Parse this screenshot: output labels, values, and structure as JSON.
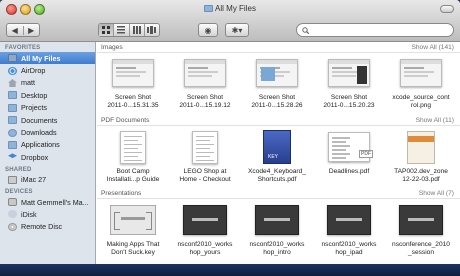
{
  "window": {
    "title": "All My Files"
  },
  "toolbar": {
    "back_glyph": "◀",
    "forward_glyph": "▶",
    "quicklook_glyph": "◉",
    "action_glyph": "✱▾",
    "search": {
      "value": "",
      "placeholder": ""
    }
  },
  "sidebar": {
    "favorites_header": "FAVORITES",
    "favorites": [
      {
        "label": "All My Files",
        "icon": "all-my-files-icon"
      },
      {
        "label": "AirDrop",
        "icon": "airdrop-icon"
      },
      {
        "label": "matt",
        "icon": "home-icon"
      },
      {
        "label": "Desktop",
        "icon": "folder-icon"
      },
      {
        "label": "Projects",
        "icon": "folder-icon"
      },
      {
        "label": "Documents",
        "icon": "documents-folder-icon"
      },
      {
        "label": "Downloads",
        "icon": "downloads-icon"
      },
      {
        "label": "Applications",
        "icon": "applications-icon"
      },
      {
        "label": "Dropbox",
        "icon": "dropbox-icon"
      }
    ],
    "shared_header": "SHARED",
    "shared": [
      {
        "label": "iMac 27",
        "icon": "imac-icon"
      }
    ],
    "devices_header": "DEVICES",
    "devices": [
      {
        "label": "Matt Gemmell's Ma...",
        "icon": "hard-disk-icon"
      },
      {
        "label": "iDisk",
        "icon": "idisk-icon"
      },
      {
        "label": "Remote Disc",
        "icon": "remote-disc-icon"
      }
    ]
  },
  "sections": {
    "images": {
      "title": "Images",
      "count": "Show All (141)",
      "items": [
        {
          "line1": "Screen Shot",
          "line2": "2011-0...15.31.35"
        },
        {
          "line1": "Screen Shot",
          "line2": "2011-0...15.19.12"
        },
        {
          "line1": "Screen Shot",
          "line2": "2011-0...15.28.26"
        },
        {
          "line1": "Screen Shot",
          "line2": "2011-0...15.20.23"
        },
        {
          "line1": "xcode_source_cont",
          "line2": "rol.png"
        }
      ]
    },
    "pdfs": {
      "title": "PDF Documents",
      "count": "Show All (11)",
      "items": [
        {
          "line1": "Boot Camp",
          "line2": "Installati...p Guide"
        },
        {
          "line1": "LEGO Shop at",
          "line2": "Home - Checkout"
        },
        {
          "line1": "Xcode4_Keyboard_",
          "line2": "Shortcuts.pdf"
        },
        {
          "line1": "Deadlines.pdf",
          "line2": ""
        },
        {
          "line1": "TAP002.dev_zone",
          "line2": "12-22-03.pdf"
        }
      ]
    },
    "presentations": {
      "title": "Presentations",
      "count": "Show All (7)",
      "items": [
        {
          "line1": "Making Apps That",
          "line2": "Don't Suck.key"
        },
        {
          "line1": "nsconf2010_works",
          "line2": "hop_yours"
        },
        {
          "line1": "nsconf2010_works",
          "line2": "hop_intro"
        },
        {
          "line1": "nsconf2010_works",
          "line2": "hop_ipad"
        },
        {
          "line1": "nsconference_2010",
          "line2": "_session"
        }
      ]
    }
  }
}
